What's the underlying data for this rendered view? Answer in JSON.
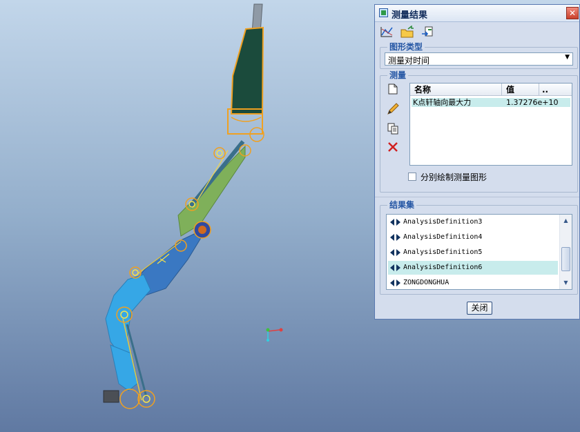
{
  "dialog": {
    "title": "测量结果",
    "toolbar": {
      "icons": [
        "graph-icon",
        "open-folder-icon",
        "export-icon"
      ]
    },
    "graph_type": {
      "label": "图形类型",
      "selected": "测量对时间"
    },
    "measure": {
      "label": "测量",
      "side_icons": [
        "new-icon",
        "edit-icon",
        "copy-icon",
        "delete-icon"
      ],
      "columns": [
        "名称",
        "值",
        ".."
      ],
      "rows": [
        {
          "name": "K点轩轴向最大力",
          "value": "1.37276e+10"
        }
      ],
      "checkbox_label": "分别绘制测量图形",
      "checkbox_checked": false
    },
    "result_set": {
      "label": "结果集",
      "items": [
        "AnalysisDefinition3",
        "AnalysisDefinition4",
        "AnalysisDefinition5",
        "AnalysisDefinition6",
        "ZONGDONGHUA"
      ],
      "selected_index": 3
    },
    "close_label": "关闭"
  },
  "colors": {
    "accent": "#2456a4",
    "selection": "#c8ecec",
    "dialog_bg": "#d4dded"
  }
}
